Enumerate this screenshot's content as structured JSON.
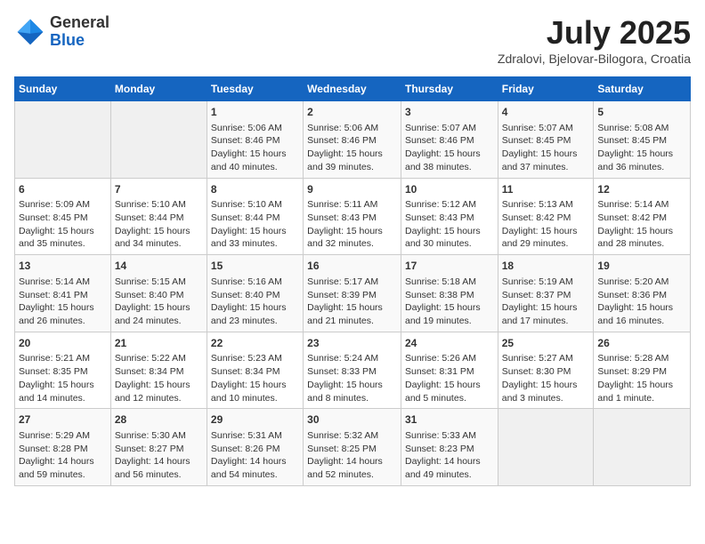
{
  "header": {
    "logo_general": "General",
    "logo_blue": "Blue",
    "month_title": "July 2025",
    "location": "Zdralovi, Bjelovar-Bilogora, Croatia"
  },
  "days_of_week": [
    "Sunday",
    "Monday",
    "Tuesday",
    "Wednesday",
    "Thursday",
    "Friday",
    "Saturday"
  ],
  "weeks": [
    [
      {
        "day": "",
        "empty": true
      },
      {
        "day": "",
        "empty": true
      },
      {
        "day": "1",
        "sunrise": "Sunrise: 5:06 AM",
        "sunset": "Sunset: 8:46 PM",
        "daylight": "Daylight: 15 hours and 40 minutes."
      },
      {
        "day": "2",
        "sunrise": "Sunrise: 5:06 AM",
        "sunset": "Sunset: 8:46 PM",
        "daylight": "Daylight: 15 hours and 39 minutes."
      },
      {
        "day": "3",
        "sunrise": "Sunrise: 5:07 AM",
        "sunset": "Sunset: 8:46 PM",
        "daylight": "Daylight: 15 hours and 38 minutes."
      },
      {
        "day": "4",
        "sunrise": "Sunrise: 5:07 AM",
        "sunset": "Sunset: 8:45 PM",
        "daylight": "Daylight: 15 hours and 37 minutes."
      },
      {
        "day": "5",
        "sunrise": "Sunrise: 5:08 AM",
        "sunset": "Sunset: 8:45 PM",
        "daylight": "Daylight: 15 hours and 36 minutes."
      }
    ],
    [
      {
        "day": "6",
        "sunrise": "Sunrise: 5:09 AM",
        "sunset": "Sunset: 8:45 PM",
        "daylight": "Daylight: 15 hours and 35 minutes."
      },
      {
        "day": "7",
        "sunrise": "Sunrise: 5:10 AM",
        "sunset": "Sunset: 8:44 PM",
        "daylight": "Daylight: 15 hours and 34 minutes."
      },
      {
        "day": "8",
        "sunrise": "Sunrise: 5:10 AM",
        "sunset": "Sunset: 8:44 PM",
        "daylight": "Daylight: 15 hours and 33 minutes."
      },
      {
        "day": "9",
        "sunrise": "Sunrise: 5:11 AM",
        "sunset": "Sunset: 8:43 PM",
        "daylight": "Daylight: 15 hours and 32 minutes."
      },
      {
        "day": "10",
        "sunrise": "Sunrise: 5:12 AM",
        "sunset": "Sunset: 8:43 PM",
        "daylight": "Daylight: 15 hours and 30 minutes."
      },
      {
        "day": "11",
        "sunrise": "Sunrise: 5:13 AM",
        "sunset": "Sunset: 8:42 PM",
        "daylight": "Daylight: 15 hours and 29 minutes."
      },
      {
        "day": "12",
        "sunrise": "Sunrise: 5:14 AM",
        "sunset": "Sunset: 8:42 PM",
        "daylight": "Daylight: 15 hours and 28 minutes."
      }
    ],
    [
      {
        "day": "13",
        "sunrise": "Sunrise: 5:14 AM",
        "sunset": "Sunset: 8:41 PM",
        "daylight": "Daylight: 15 hours and 26 minutes."
      },
      {
        "day": "14",
        "sunrise": "Sunrise: 5:15 AM",
        "sunset": "Sunset: 8:40 PM",
        "daylight": "Daylight: 15 hours and 24 minutes."
      },
      {
        "day": "15",
        "sunrise": "Sunrise: 5:16 AM",
        "sunset": "Sunset: 8:40 PM",
        "daylight": "Daylight: 15 hours and 23 minutes."
      },
      {
        "day": "16",
        "sunrise": "Sunrise: 5:17 AM",
        "sunset": "Sunset: 8:39 PM",
        "daylight": "Daylight: 15 hours and 21 minutes."
      },
      {
        "day": "17",
        "sunrise": "Sunrise: 5:18 AM",
        "sunset": "Sunset: 8:38 PM",
        "daylight": "Daylight: 15 hours and 19 minutes."
      },
      {
        "day": "18",
        "sunrise": "Sunrise: 5:19 AM",
        "sunset": "Sunset: 8:37 PM",
        "daylight": "Daylight: 15 hours and 17 minutes."
      },
      {
        "day": "19",
        "sunrise": "Sunrise: 5:20 AM",
        "sunset": "Sunset: 8:36 PM",
        "daylight": "Daylight: 15 hours and 16 minutes."
      }
    ],
    [
      {
        "day": "20",
        "sunrise": "Sunrise: 5:21 AM",
        "sunset": "Sunset: 8:35 PM",
        "daylight": "Daylight: 15 hours and 14 minutes."
      },
      {
        "day": "21",
        "sunrise": "Sunrise: 5:22 AM",
        "sunset": "Sunset: 8:34 PM",
        "daylight": "Daylight: 15 hours and 12 minutes."
      },
      {
        "day": "22",
        "sunrise": "Sunrise: 5:23 AM",
        "sunset": "Sunset: 8:34 PM",
        "daylight": "Daylight: 15 hours and 10 minutes."
      },
      {
        "day": "23",
        "sunrise": "Sunrise: 5:24 AM",
        "sunset": "Sunset: 8:33 PM",
        "daylight": "Daylight: 15 hours and 8 minutes."
      },
      {
        "day": "24",
        "sunrise": "Sunrise: 5:26 AM",
        "sunset": "Sunset: 8:31 PM",
        "daylight": "Daylight: 15 hours and 5 minutes."
      },
      {
        "day": "25",
        "sunrise": "Sunrise: 5:27 AM",
        "sunset": "Sunset: 8:30 PM",
        "daylight": "Daylight: 15 hours and 3 minutes."
      },
      {
        "day": "26",
        "sunrise": "Sunrise: 5:28 AM",
        "sunset": "Sunset: 8:29 PM",
        "daylight": "Daylight: 15 hours and 1 minute."
      }
    ],
    [
      {
        "day": "27",
        "sunrise": "Sunrise: 5:29 AM",
        "sunset": "Sunset: 8:28 PM",
        "daylight": "Daylight: 14 hours and 59 minutes."
      },
      {
        "day": "28",
        "sunrise": "Sunrise: 5:30 AM",
        "sunset": "Sunset: 8:27 PM",
        "daylight": "Daylight: 14 hours and 56 minutes."
      },
      {
        "day": "29",
        "sunrise": "Sunrise: 5:31 AM",
        "sunset": "Sunset: 8:26 PM",
        "daylight": "Daylight: 14 hours and 54 minutes."
      },
      {
        "day": "30",
        "sunrise": "Sunrise: 5:32 AM",
        "sunset": "Sunset: 8:25 PM",
        "daylight": "Daylight: 14 hours and 52 minutes."
      },
      {
        "day": "31",
        "sunrise": "Sunrise: 5:33 AM",
        "sunset": "Sunset: 8:23 PM",
        "daylight": "Daylight: 14 hours and 49 minutes."
      },
      {
        "day": "",
        "empty": true
      },
      {
        "day": "",
        "empty": true
      }
    ]
  ]
}
